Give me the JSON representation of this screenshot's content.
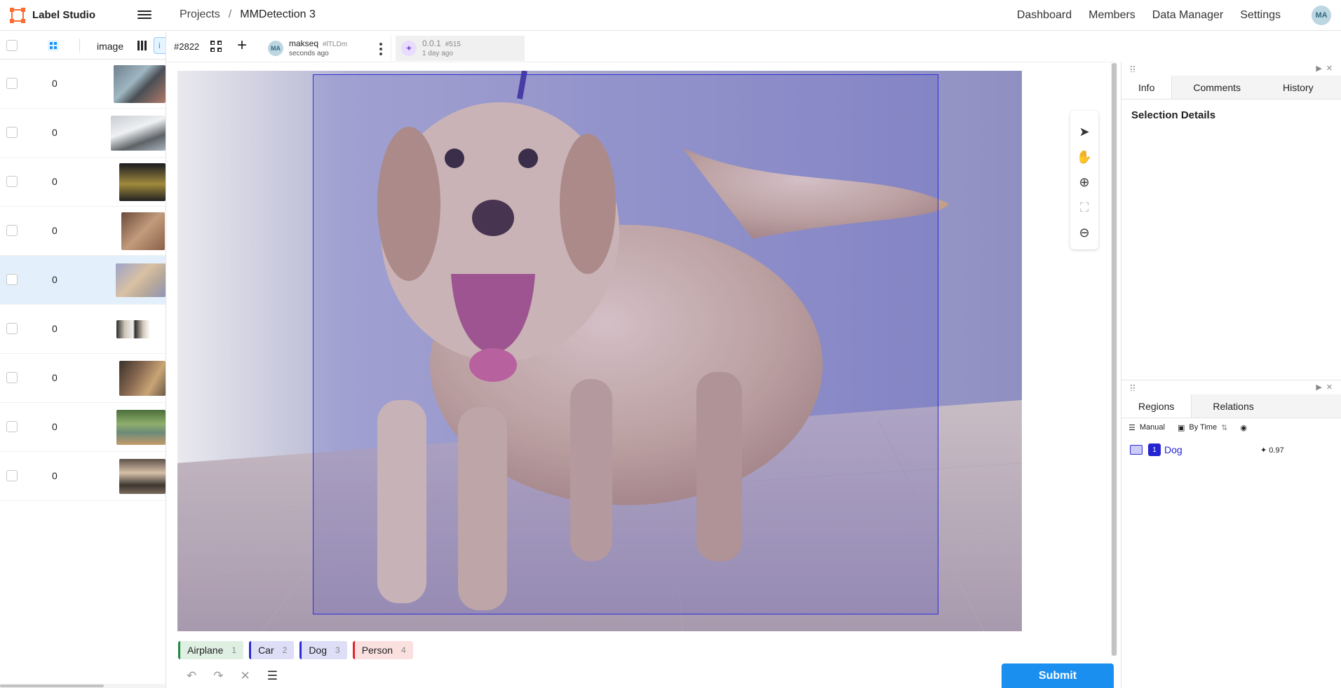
{
  "app": {
    "name": "Label Studio"
  },
  "breadcrumb": {
    "projects": "Projects",
    "separator": "/",
    "project": "MMDetection 3"
  },
  "topnav": {
    "items": [
      "Dashboard",
      "Members",
      "Data Manager",
      "Settings"
    ],
    "user_initials": "MA"
  },
  "task_list": {
    "column_label": "image",
    "column_button": "i",
    "rows": [
      {
        "value": "0",
        "selected": false
      },
      {
        "value": "0",
        "selected": false
      },
      {
        "value": "0",
        "selected": false
      },
      {
        "value": "0",
        "selected": false
      },
      {
        "value": "0",
        "selected": true
      },
      {
        "value": "0",
        "selected": false
      },
      {
        "value": "0",
        "selected": false
      },
      {
        "value": "0",
        "selected": false
      },
      {
        "value": "0",
        "selected": false
      }
    ]
  },
  "task": {
    "id": "#2822"
  },
  "annotations": [
    {
      "initials": "MA",
      "user": "makseq",
      "hash": "#lTLDm",
      "time": "seconds ago"
    },
    {
      "initials": "✦",
      "user": "0.0.1",
      "hash": "#515",
      "time": "1 day ago"
    }
  ],
  "labels": [
    {
      "name": "Airplane",
      "key": "1",
      "color": "#1f8a3e",
      "bg": "#dff0e3"
    },
    {
      "name": "Car",
      "key": "2",
      "color": "#2b2bd4",
      "bg": "#dedef7"
    },
    {
      "name": "Dog",
      "key": "3",
      "color": "#2b2bd4",
      "bg": "#dedef7"
    },
    {
      "name": "Person",
      "key": "4",
      "color": "#e0242a",
      "bg": "#fbe0e0"
    }
  ],
  "submit_label": "Submit",
  "info_panel": {
    "tabs": [
      "Info",
      "Comments",
      "History"
    ],
    "title": "Selection Details"
  },
  "regions_panel": {
    "tabs": [
      "Regions",
      "Relations"
    ],
    "order": "Manual",
    "sort": "By Time",
    "regions": [
      {
        "index": "1",
        "label": "Dog",
        "score": "0.97"
      }
    ]
  },
  "colors": {
    "accent": "#1b8ff0",
    "region": "#2f2fd8"
  }
}
